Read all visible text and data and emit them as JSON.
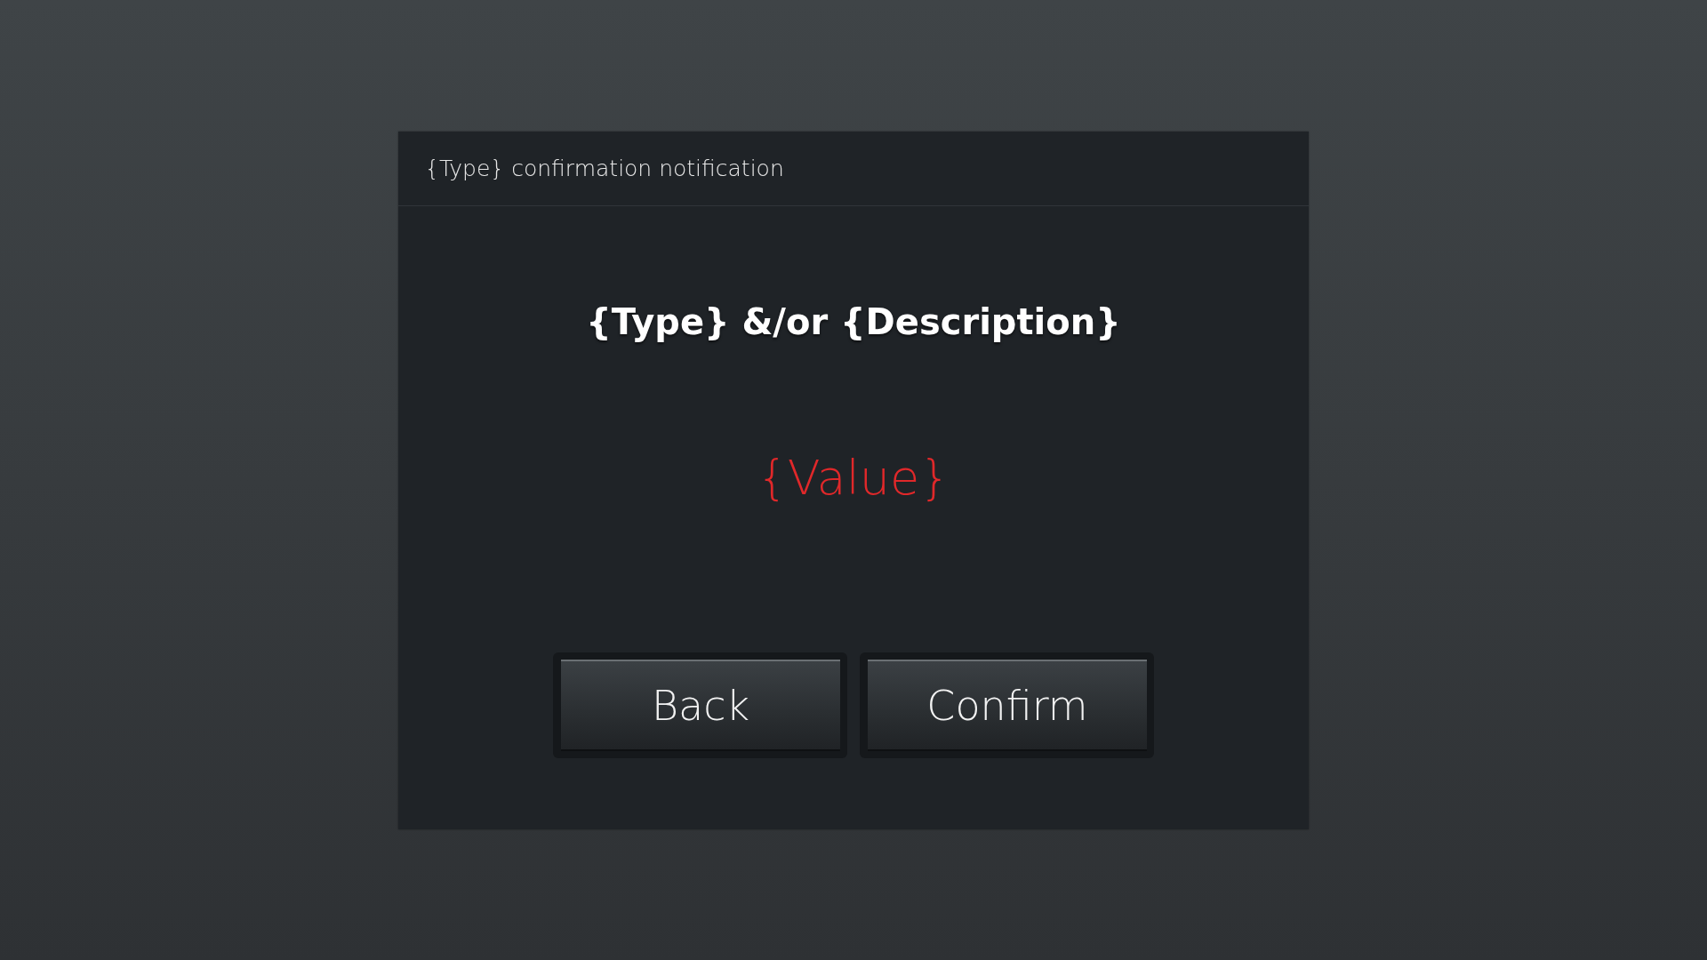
{
  "dialog": {
    "title": "{Type} confirmation notification",
    "heading": "{Type} &/or {Description}",
    "value": "{Value}",
    "buttons": [
      {
        "label": "Back"
      },
      {
        "label": "Confirm"
      }
    ]
  }
}
